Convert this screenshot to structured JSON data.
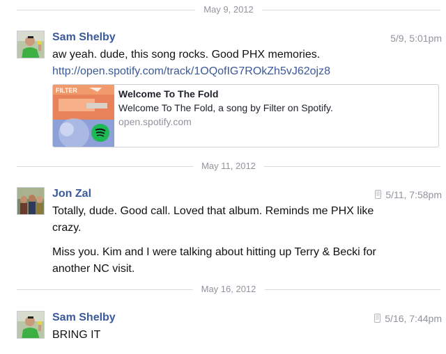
{
  "dividers": [
    "May 9, 2012",
    "May 11, 2012",
    "May 16, 2012"
  ],
  "messages": [
    {
      "author": "Sam Shelby",
      "time": "5/9, 5:01pm",
      "text": "aw yeah. dude, this song rocks. Good PHX memories.",
      "link": "http://open.spotify.com/track/1OQofIG7ROkZh5vJ62ojz8",
      "card": {
        "thumb_label": "FILTER",
        "title": "Welcome To The Fold",
        "description": "Welcome To The Fold, a song by Filter on Spotify.",
        "domain": "open.spotify.com"
      }
    },
    {
      "author": "Jon Zal",
      "time": "5/11, 7:58pm",
      "paragraph1": "Totally, dude. Good call. Loved that album. Reminds me PHX like crazy.",
      "paragraph2": "Miss you. Kim and I were talking about hitting up Terry & Becki for another NC visit."
    },
    {
      "author": "Sam Shelby",
      "time": "5/16, 7:44pm",
      "text": "BRING IT"
    }
  ],
  "colors": {
    "author": "#3b5998",
    "link": "#3b5998",
    "muted": "#90949c",
    "divider_line": "#d7dae0",
    "spotify_green": "#1db954",
    "album_orange": "#e8825a"
  },
  "icons": [
    "mobile-phone-icon",
    "spotify-logo-icon"
  ]
}
